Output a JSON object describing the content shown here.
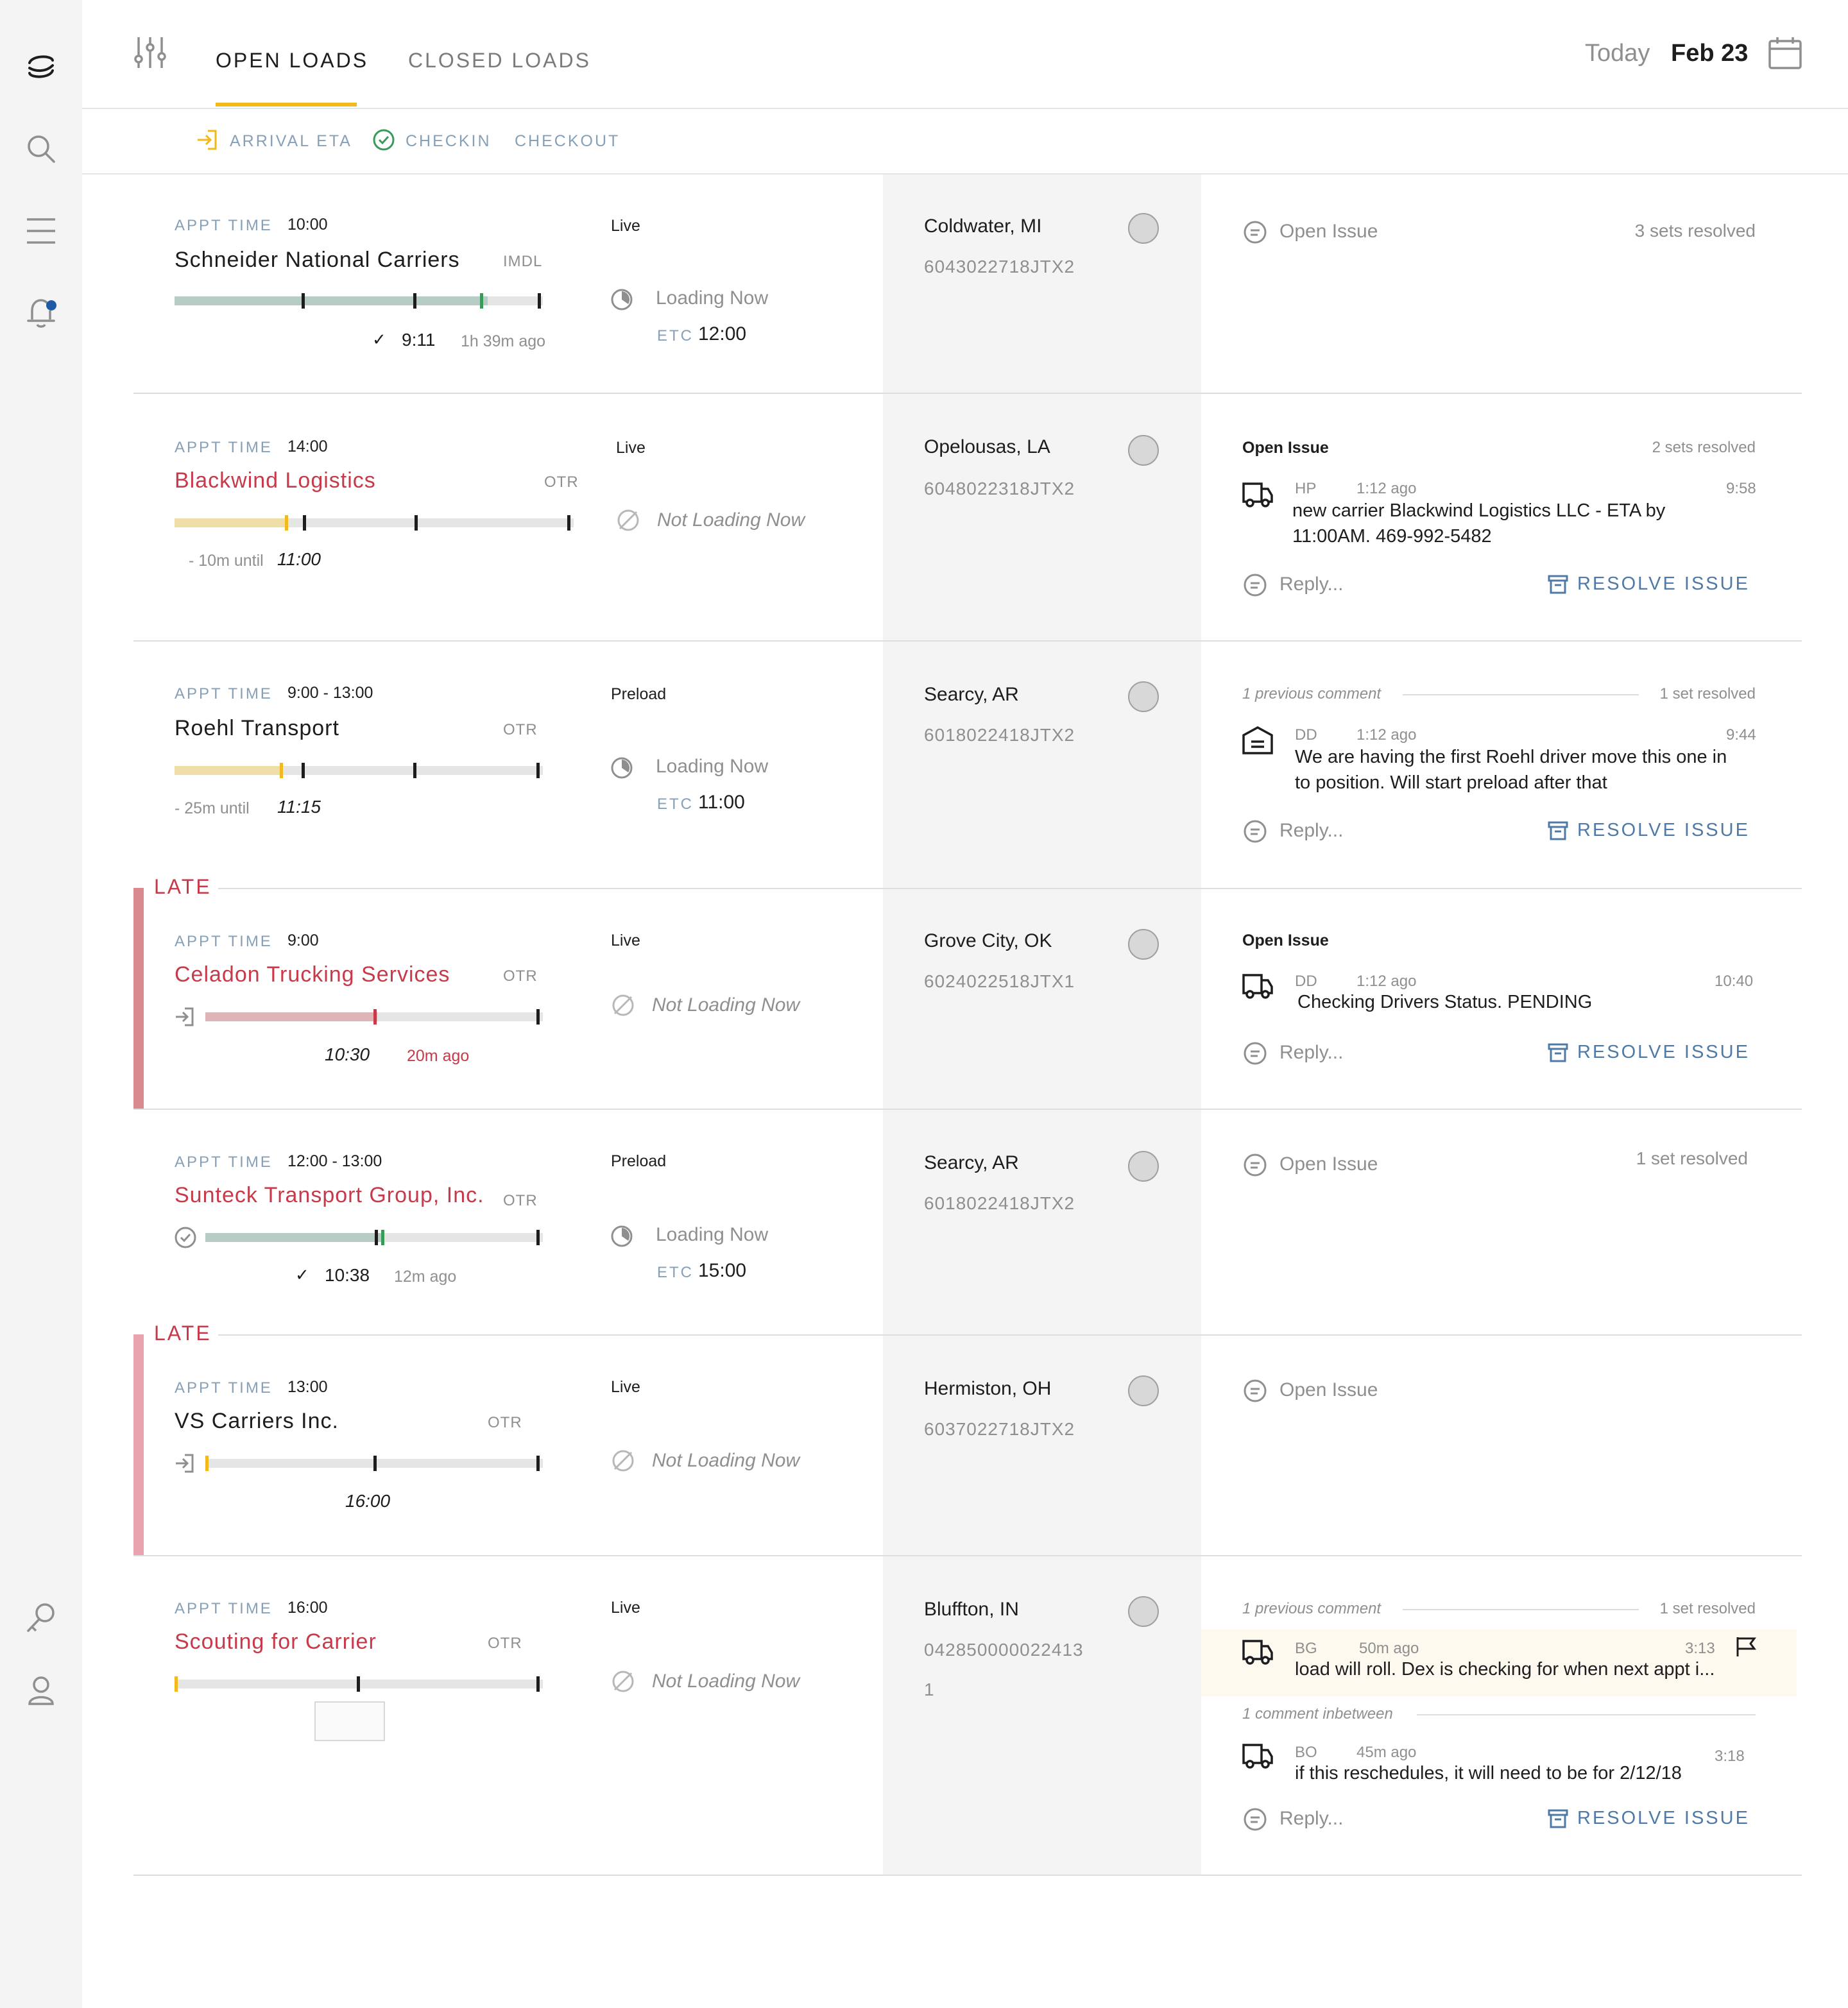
{
  "topbar": {
    "tabs": [
      {
        "label": "OPEN LOADS"
      },
      {
        "label": "CLOSED LOADS"
      }
    ],
    "today_label": "Today",
    "date": "Feb 23"
  },
  "subtabs": [
    {
      "label": "ARRIVAL ETA"
    },
    {
      "label": "CHECKIN"
    },
    {
      "label": "CHECKOUT"
    }
  ],
  "colors": {
    "accent": "#f1b91b",
    "late": "#c73a4a",
    "link": "#4f79a6",
    "label": "#86a0b8",
    "progress_green": "#b7ccc4",
    "progress_yellow": "#efdfa6",
    "progress_red": "#dfb4b6"
  },
  "late_label": "LATE",
  "appt_label": "APPT TIME",
  "etc_label": "ETC",
  "reply_placeholder": "Reply...",
  "resolve_label": "RESOLVE ISSUE",
  "open_issue_label": "Open Issue",
  "loads": [
    {
      "appt": "10:00",
      "carrier": "Schneider National Carriers",
      "type": "IMDL",
      "progress_fill": 0.85,
      "time_check": "9:11",
      "time_ago": "1h 39m ago",
      "mode": "Live",
      "status": "Loading Now",
      "etc": "12:00",
      "city": "Coldwater, MI",
      "ref": "6043022718JTX2",
      "sets": "3 sets resolved"
    },
    {
      "appt": "14:00",
      "carrier": "Blackwind Logistics",
      "type": "OTR",
      "progress_fill": 0.28,
      "until_label": "- 10m until",
      "until_time": "11:00",
      "mode": "Live",
      "status": "Not Loading Now",
      "city": "Opelousas, LA",
      "ref": "6048022318JTX2",
      "issue_header": "Open Issue",
      "sets": "2 sets resolved",
      "comment": {
        "who": "HP",
        "ago": "1:12 ago",
        "time": "9:58",
        "line1": "new carrier Blackwind Logistics LLC - ETA by",
        "line2": "11:00AM.  469-992-5482"
      }
    },
    {
      "appt": "9:00 - 13:00",
      "carrier": "Roehl Transport",
      "type": "OTR",
      "progress_fill": 0.29,
      "until_label": "- 25m until",
      "until_time": "11:15",
      "mode": "Preload",
      "status": "Loading Now",
      "etc": "11:00",
      "city": "Searcy, AR",
      "ref": "6018022418JTX2",
      "prev": "1 previous comment",
      "sets": "1 set resolved",
      "comment": {
        "who": "DD",
        "ago": "1:12 ago",
        "time": "9:44",
        "line1": "We are having the first Roehl driver move this one in",
        "line2": "to position.  Will start preload after that"
      }
    },
    {
      "appt": "9:00",
      "carrier": "Celadon Trucking Services",
      "type": "OTR",
      "progress_fill": 0.51,
      "time_label": "10:30",
      "time_ago": "20m ago",
      "mode": "Live",
      "status": "Not Loading Now",
      "city": "Grove City, OK",
      "ref": "6024022518JTX1",
      "issue_header": "Open Issue",
      "comment": {
        "who": "DD",
        "ago": "1:12 ago",
        "time": "10:40",
        "line1": "Checking Drivers Status. PENDING"
      }
    },
    {
      "appt": "12:00 - 13:00",
      "carrier": "Sunteck Transport Group, Inc.",
      "type": "OTR",
      "progress_fill": 0.53,
      "time_check": "10:38",
      "time_ago": "12m ago",
      "mode": "Preload",
      "status": "Loading Now",
      "etc": "15:00",
      "city": "Searcy, AR",
      "ref": "6018022418JTX2",
      "sets": "1 set resolved"
    },
    {
      "appt": "13:00",
      "carrier": "VS Carriers Inc.",
      "type": "OTR",
      "progress_fill": 0.0,
      "time_label": "16:00",
      "mode": "Live",
      "status": "Not Loading Now",
      "city": "Hermiston, OH",
      "ref": "6037022718JTX2"
    },
    {
      "appt": "16:00",
      "carrier": "Scouting for Carrier",
      "type": "OTR",
      "progress_fill": 0.0,
      "mode": "Live",
      "status": "Not Loading Now",
      "city": "Bluffton, IN",
      "ref": "042850000022413",
      "ref2": "1",
      "prev": "1 previous comment",
      "sets": "1 set resolved",
      "comment": {
        "who": "BG",
        "ago": "50m ago",
        "time": "3:13",
        "line1": "load will roll.  Dex is checking for when next appt i..."
      },
      "between": "1 comment inbetween",
      "comment2": {
        "who": "BO",
        "ago": "45m ago",
        "time": "3:18",
        "line1": "if this reschedules, it will need to be for 2/12/18"
      }
    }
  ]
}
